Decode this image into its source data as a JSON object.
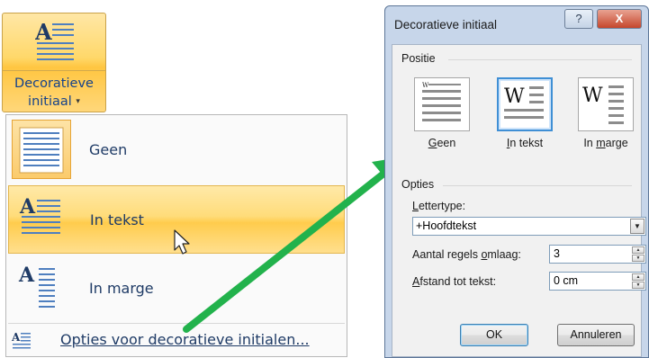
{
  "ribbon_button": {
    "label_line1": "Decoratieve",
    "label_line2": "initiaal",
    "caret": "▾",
    "icon": "drop-cap-icon"
  },
  "menu": {
    "items": [
      {
        "label": "Geen",
        "icon": "no-drop-cap-icon",
        "selected": true
      },
      {
        "label": "In tekst",
        "icon": "drop-cap-in-text-icon",
        "hovered": true
      },
      {
        "label": "In marge",
        "icon": "drop-cap-in-margin-icon"
      }
    ],
    "footer_label": "Opties voor decoratieve initialen...",
    "footer_icon": "drop-cap-options-icon"
  },
  "dialog": {
    "title": "Decoratieve initiaal",
    "help_glyph": "?",
    "close_glyph": "X",
    "position_group": "Positie",
    "positions": [
      {
        "label_pre": "",
        "label_acc": "G",
        "label_post": "een",
        "selected": false
      },
      {
        "label_pre": "",
        "label_acc": "I",
        "label_post": "n tekst",
        "selected": true
      },
      {
        "label_pre": "In ",
        "label_acc": "m",
        "label_post": "arge",
        "selected": false
      }
    ],
    "options_group": "Opties",
    "font_label_pre": "",
    "font_label_acc": "L",
    "font_label_post": "ettertype:",
    "font_value": "+Hoofdtekst",
    "lines_label_pre": "Aantal regels ",
    "lines_label_acc": "o",
    "lines_label_post": "mlaag:",
    "lines_value": "3",
    "distance_label_pre": "",
    "distance_label_acc": "A",
    "distance_label_post": "fstand tot tekst:",
    "distance_value": "0 cm",
    "ok_label": "OK",
    "cancel_label": "Annuleren"
  },
  "colors": {
    "ribbon_highlight": "#ffd86a",
    "menu_text": "#1f3b66",
    "arrow": "#22b24c",
    "dialog_frame": "#c7d6ea"
  }
}
